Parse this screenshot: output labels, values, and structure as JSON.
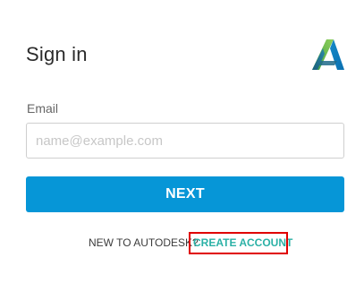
{
  "signin": {
    "title": "Sign in"
  },
  "logo": {
    "name": "autodesk-logo-icon",
    "colors": [
      "#1e6a8a",
      "#5fb84f",
      "#0696d7"
    ]
  },
  "email": {
    "label": "Email",
    "placeholder": "name@example.com",
    "value": ""
  },
  "next_button": {
    "label": "NEXT",
    "color": "#0696d7"
  },
  "footer": {
    "prompt": "NEW TO AUTODESK?",
    "create_account_label": "CREATE ACCOUNT",
    "link_color": "#2bb1a6"
  },
  "annotation": {
    "highlight_color": "#e00000"
  }
}
